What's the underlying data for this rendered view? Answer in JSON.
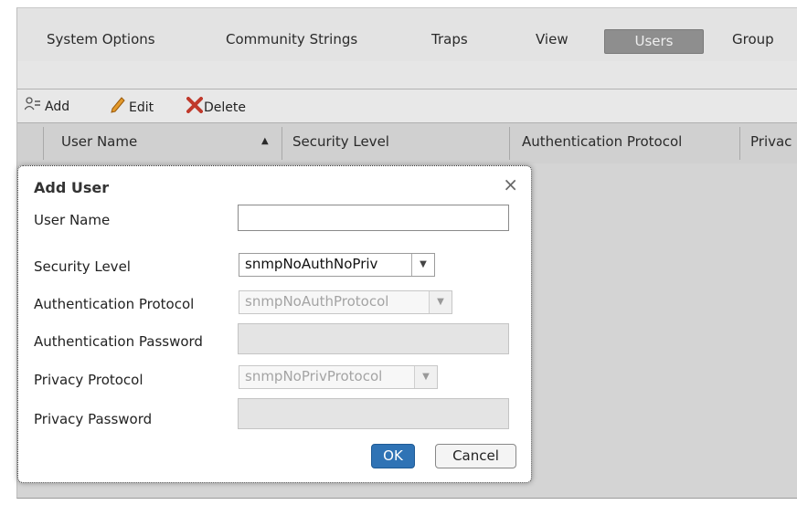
{
  "tabs": [
    {
      "label": "System Options"
    },
    {
      "label": "Community Strings"
    },
    {
      "label": "Traps"
    },
    {
      "label": "View"
    },
    {
      "label": "Users"
    },
    {
      "label": "Group"
    }
  ],
  "toolbar": {
    "add_label": "Add",
    "edit_label": "Edit",
    "delete_label": "Delete"
  },
  "columns": {
    "user_name": "User Name",
    "security_level": "Security Level",
    "auth_protocol": "Authentication Protocol",
    "privacy": "Privac"
  },
  "dialog": {
    "title": "Add User",
    "close": "×",
    "user_name_label": "User Name",
    "user_name_value": "",
    "security_level_label": "Security Level",
    "security_level_value": "snmpNoAuthNoPriv",
    "auth_protocol_label": "Authentication Protocol",
    "auth_protocol_value": "snmpNoAuthProtocol",
    "auth_password_label": "Authentication Password",
    "privacy_protocol_label": "Privacy Protocol",
    "privacy_protocol_value": "snmpNoPrivProtocol",
    "privacy_password_label": "Privacy Password",
    "ok_label": "OK",
    "cancel_label": "Cancel"
  },
  "icons": {
    "add": "add-user-icon",
    "edit": "pencil-icon",
    "delete": "x-icon",
    "sort": "sort-ascending-icon",
    "dropdown": "chevron-down-icon"
  },
  "colors": {
    "active_tab": "#8e8e8e",
    "ok_button": "#2f73b5",
    "delete_icon": "#c0392b",
    "edit_icon": "#d4891a"
  }
}
